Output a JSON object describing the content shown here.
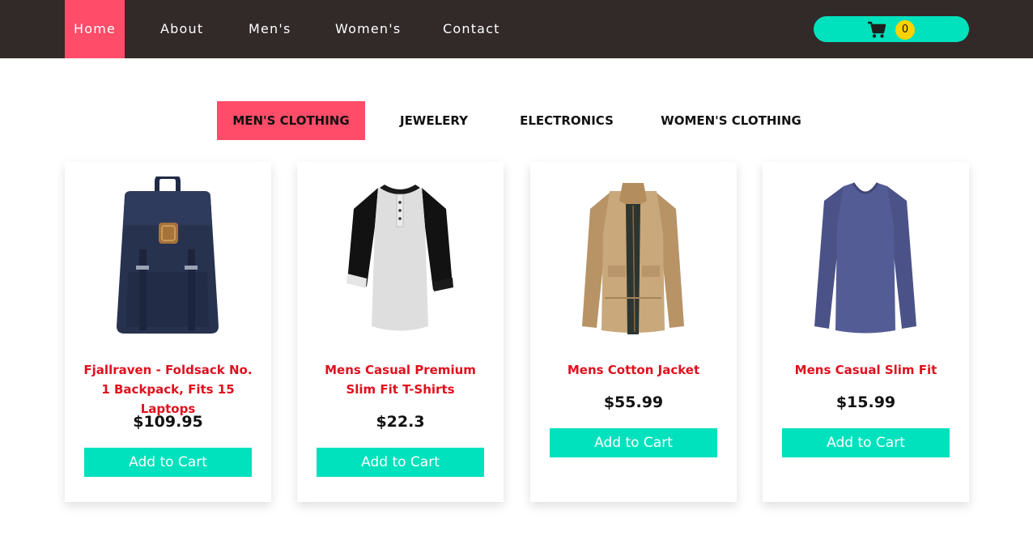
{
  "nav": {
    "links": [
      {
        "label": "Home",
        "active": true
      },
      {
        "label": "About"
      },
      {
        "label": "Men's"
      },
      {
        "label": "Women's"
      },
      {
        "label": "Contact"
      }
    ],
    "cart": {
      "icon": "shopping-cart-icon",
      "count": "0"
    }
  },
  "categories": [
    {
      "label": "MEN'S CLOTHING",
      "active": true
    },
    {
      "label": "JEWELERY"
    },
    {
      "label": "ELECTRONICS"
    },
    {
      "label": "WOMEN'S CLOTHING"
    }
  ],
  "products": [
    {
      "title": "Fjallraven - Foldsack No. 1 Backpack, Fits 15 Laptops",
      "price": "$109.95",
      "button": "Add to Cart",
      "image": "backpack-image"
    },
    {
      "title": "Mens Casual Premium Slim Fit T-Shirts",
      "price": "$22.3",
      "button": "Add to Cart",
      "image": "raglan-tshirt-image"
    },
    {
      "title": "Mens Cotton Jacket",
      "price": "$55.99",
      "button": "Add to Cart",
      "image": "cotton-jacket-image"
    },
    {
      "title": "Mens Casual Slim Fit",
      "price": "$15.99",
      "button": "Add to Cart",
      "image": "slim-fit-shirt-image"
    }
  ],
  "colors": {
    "nav_bg": "#322929",
    "accent_pink": "#ff4c68",
    "accent_teal": "#00e1bd",
    "badge_yellow": "#ffd200",
    "title_red": "#e0101e"
  }
}
